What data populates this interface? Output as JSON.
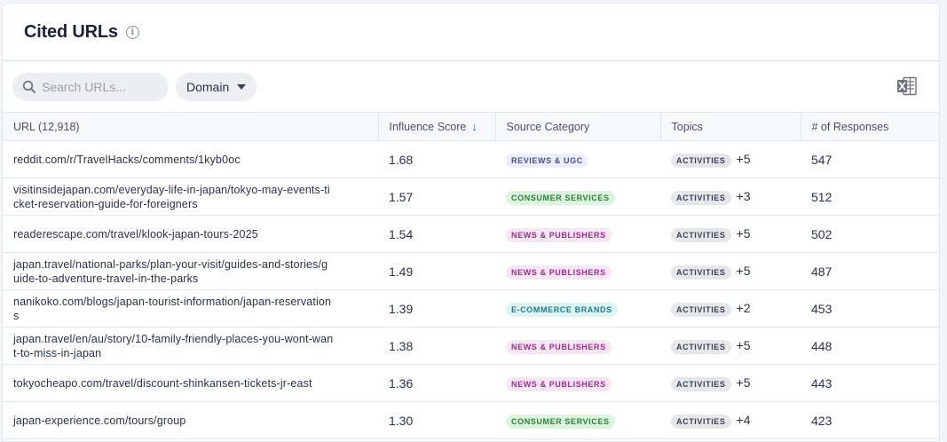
{
  "header": {
    "title": "Cited URLs",
    "info_icon": "info-icon"
  },
  "toolbar": {
    "search_placeholder": "Search URLs...",
    "search_icon": "search-icon",
    "domain_label": "Domain",
    "export_icon": "excel-export-icon"
  },
  "table": {
    "columns": {
      "url": "URL (12,918)",
      "influence": "Influence Score",
      "source": "Source Category",
      "topics": "Topics",
      "responses": "# of Responses"
    },
    "sort_icon": "arrow-down-icon",
    "rows": [
      {
        "url": "reddit.com/r/TravelHacks/comments/1kyb0oc",
        "score": "1.68",
        "category": "REVIEWS & UGC",
        "category_type": "reviews",
        "topic": "ACTIVITIES",
        "more": "+5",
        "responses": "547"
      },
      {
        "url": "visitinsidejapan.com/everyday-life-in-japan/tokyo-may-events-ticket-reservation-guide-for-foreigners",
        "score": "1.57",
        "category": "CONSUMER SERVICES",
        "category_type": "consumer",
        "topic": "ACTIVITIES",
        "more": "+3",
        "responses": "512"
      },
      {
        "url": "readerescape.com/travel/klook-japan-tours-2025",
        "score": "1.54",
        "category": "NEWS & PUBLISHERS",
        "category_type": "news",
        "topic": "ACTIVITIES",
        "more": "+5",
        "responses": "502"
      },
      {
        "url": "japan.travel/national-parks/plan-your-visit/guides-and-stories/guide-to-adventure-travel-in-the-parks",
        "score": "1.49",
        "category": "NEWS & PUBLISHERS",
        "category_type": "news",
        "topic": "ACTIVITIES",
        "more": "+5",
        "responses": "487"
      },
      {
        "url": "nanikoko.com/blogs/japan-tourist-information/japan-reservations",
        "score": "1.39",
        "category": "E-COMMERCE BRANDS",
        "category_type": "ecommerce",
        "topic": "ACTIVITIES",
        "more": "+2",
        "responses": "453"
      },
      {
        "url": "japan.travel/en/au/story/10-family-friendly-places-you-wont-want-to-miss-in-japan",
        "score": "1.38",
        "category": "NEWS & PUBLISHERS",
        "category_type": "news",
        "topic": "ACTIVITIES",
        "more": "+5",
        "responses": "448"
      },
      {
        "url": "tokyocheapo.com/travel/discount-shinkansen-tickets-jr-east",
        "score": "1.36",
        "category": "NEWS & PUBLISHERS",
        "category_type": "news",
        "topic": "ACTIVITIES",
        "more": "+5",
        "responses": "443"
      },
      {
        "url": "japan-experience.com/tours/group",
        "score": "1.30",
        "category": "CONSUMER SERVICES",
        "category_type": "consumer",
        "topic": "ACTIVITIES",
        "more": "+4",
        "responses": "423"
      }
    ]
  },
  "colors": {
    "reviews": {
      "bg": "#eceefb",
      "fg": "#4b4f8f"
    },
    "consumer": {
      "bg": "#dcf5de",
      "fg": "#2e7d3a"
    },
    "news": {
      "bg": "#f8e6f5",
      "fg": "#9b2f8f"
    },
    "ecommerce": {
      "bg": "#dcf4f4",
      "fg": "#1f7e85"
    }
  }
}
